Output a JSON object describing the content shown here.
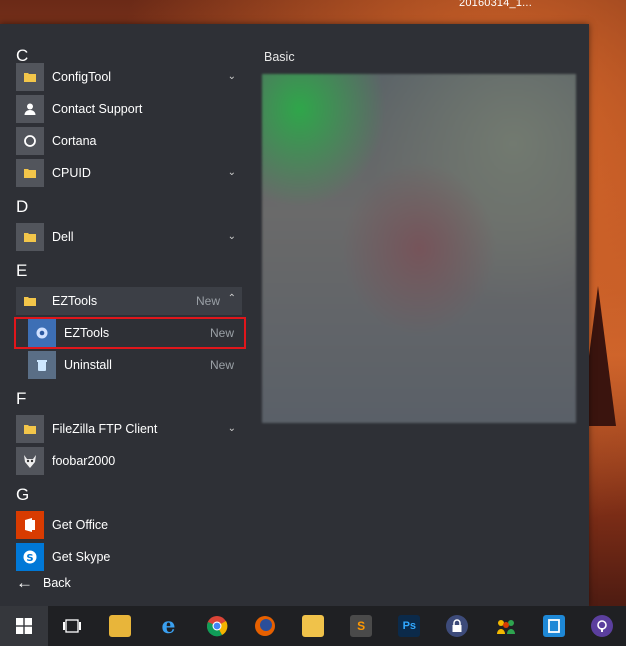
{
  "desktop": {
    "icon_label": "20160314_1..."
  },
  "start_menu": {
    "letters": {
      "c": "C",
      "d": "D",
      "e": "E",
      "f": "F",
      "g": "G"
    },
    "apps": {
      "configtool": "ConfigTool",
      "contact_support": "Contact Support",
      "cortana": "Cortana",
      "cpuid": "CPUID",
      "dell": "Dell",
      "eztools_folder": "EZTools",
      "eztools_folder_badge": "New",
      "eztools_app": "EZTools",
      "eztools_app_badge": "New",
      "uninstall": "Uninstall",
      "uninstall_badge": "New",
      "filezilla": "FileZilla FTP Client",
      "foobar": "foobar2000",
      "get_office": "Get Office",
      "get_skype": "Get Skype"
    },
    "back_label": "Back",
    "tile_group_title": "Basic"
  },
  "icons": {
    "folder": "folder-icon",
    "person": "person-icon",
    "cortana": "cortana-circle-icon",
    "gear": "gear-icon",
    "recycle": "recycle-icon",
    "foobar": "foobar-icon",
    "office": "office-icon",
    "skype": "skype-icon",
    "back": "back-arrow-icon"
  },
  "colors": {
    "accent_highlight": "#e0161b",
    "menu_bg": "#2e3036",
    "badge_text": "#9aa0a6"
  }
}
